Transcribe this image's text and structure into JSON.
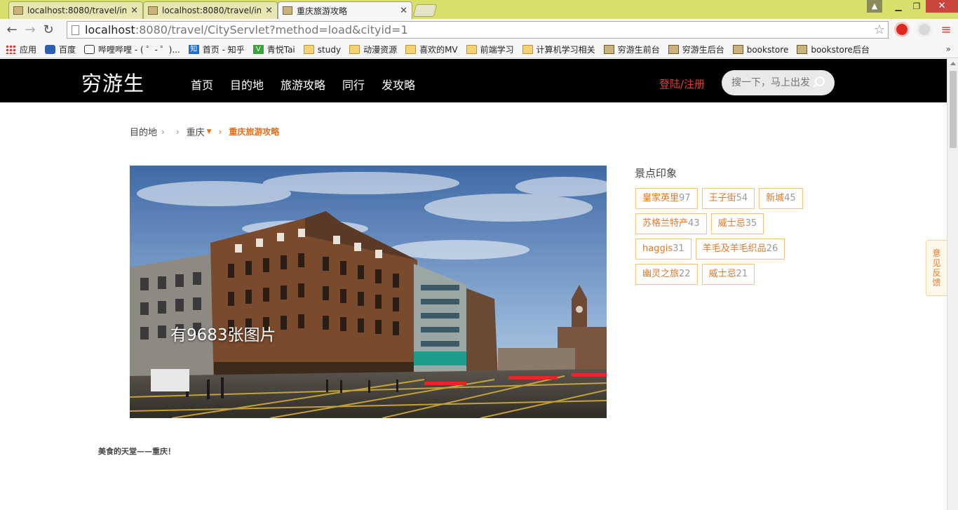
{
  "browser": {
    "tabs": [
      {
        "title": "localhost:8080/travel/in",
        "active": false
      },
      {
        "title": "localhost:8080/travel/in",
        "active": false
      },
      {
        "title": "重庆旅游攻略",
        "active": true
      }
    ],
    "url": {
      "host": "localhost",
      "rest": ":8080/travel/CityServlet?method=load&cityid=1"
    },
    "bookmarks": [
      {
        "label": "应用",
        "icon": "apps-icon"
      },
      {
        "label": "百度",
        "icon": "baidu-paw-icon"
      },
      {
        "label": "哔哩哔哩 - ( ゜- ゜)...",
        "icon": "bilibili-tv-icon"
      },
      {
        "label": "首页 - 知乎",
        "icon": "zhihu-icon"
      },
      {
        "label": "青悦Tai",
        "icon": "green-v-icon"
      },
      {
        "label": "study",
        "icon": "folder-icon"
      },
      {
        "label": "动漫资源",
        "icon": "folder-icon"
      },
      {
        "label": "喜欢的MV",
        "icon": "folder-icon"
      },
      {
        "label": "前端学习",
        "icon": "folder-icon"
      },
      {
        "label": "计算机学习相关",
        "icon": "folder-icon"
      },
      {
        "label": "穷游生前台",
        "icon": "page-image-icon"
      },
      {
        "label": "穷游生后台",
        "icon": "page-image-icon"
      },
      {
        "label": "bookstore",
        "icon": "page-image-icon"
      },
      {
        "label": "bookstore后台",
        "icon": "page-image-icon"
      }
    ],
    "bookmarks_more": "»"
  },
  "site": {
    "logo": "穷游生",
    "nav": [
      "首页",
      "目的地",
      "旅游攻略",
      "同行",
      "发攻略"
    ],
    "login": "登陆/注册",
    "search_placeholder": "搜一下，马上出发"
  },
  "breadcrumb": {
    "root": "目的地",
    "city": "重庆",
    "current": "重庆旅游攻略"
  },
  "hero": {
    "photo_count_text": "有9683张图片"
  },
  "impressions": {
    "title": "景点印象",
    "tags": [
      {
        "name": "皇家英里",
        "count": "97"
      },
      {
        "name": "王子街",
        "count": "54"
      },
      {
        "name": "新城",
        "count": "45"
      },
      {
        "name": "苏格兰特产",
        "count": "43"
      },
      {
        "name": "威士忌",
        "count": "35"
      },
      {
        "name": "haggis",
        "count": "31"
      },
      {
        "name": "羊毛及羊毛织品",
        "count": "26"
      },
      {
        "name": "幽灵之旅",
        "count": "22"
      },
      {
        "name": "威士忌",
        "count": "21"
      }
    ]
  },
  "intro": "美食的天堂——重庆！",
  "feedback": [
    "意",
    "见",
    "反",
    "馈"
  ]
}
